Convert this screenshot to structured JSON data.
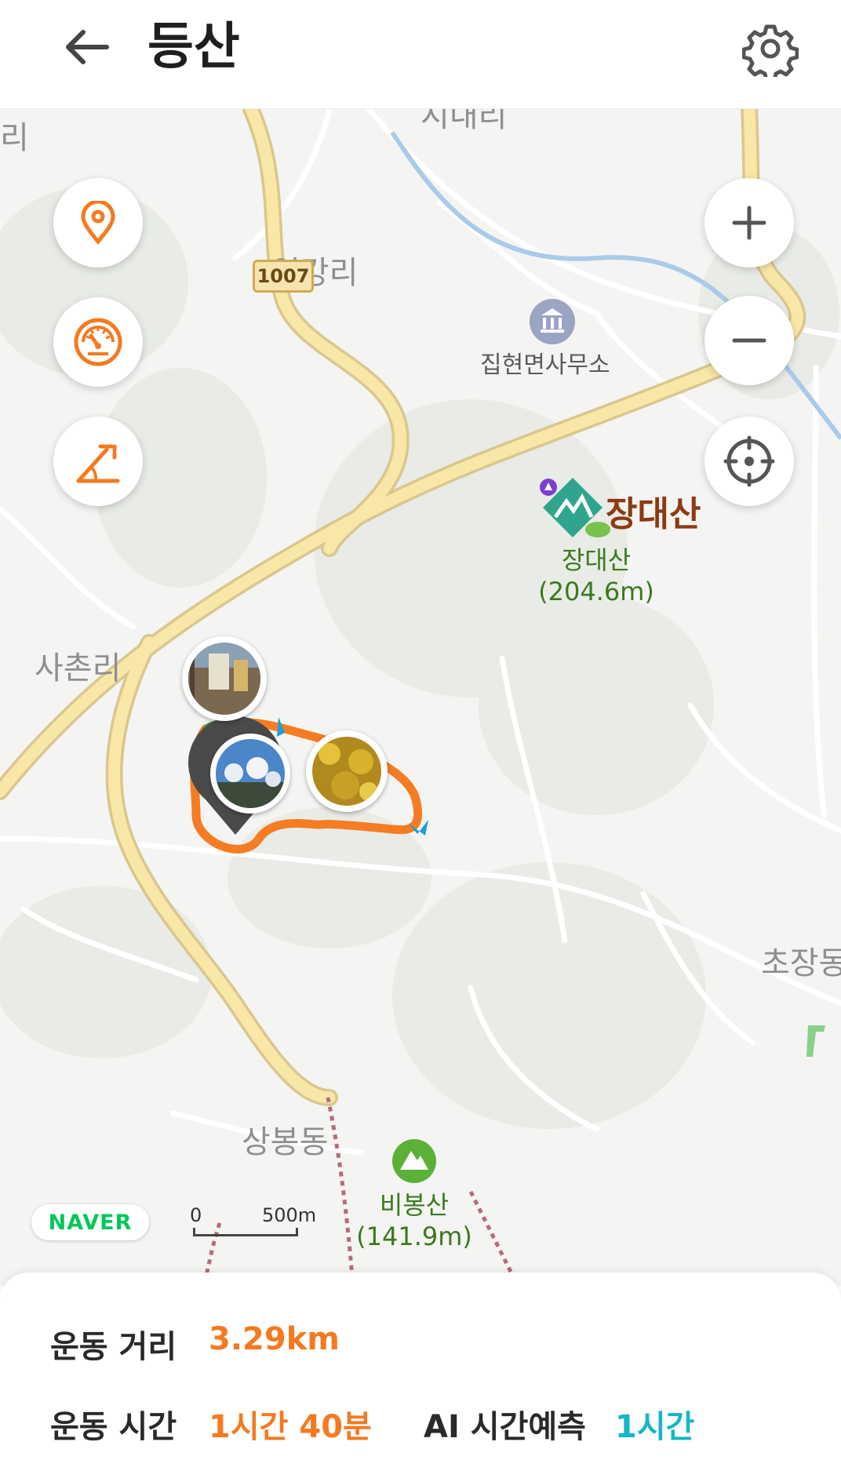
{
  "header": {
    "title": "등산",
    "back_icon": "arrow-left-icon",
    "settings_icon": "gear-icon"
  },
  "map": {
    "place_labels": {
      "top_left_cut": "리",
      "top_center_cut": "시내리",
      "ilgang": "일강리",
      "sachon": "사촌리",
      "sangbong": "상봉동",
      "chojang": "초장동"
    },
    "road_number": "1007",
    "office": "집현면사무소",
    "mountains": [
      {
        "name": "장대산",
        "height": "(204.6m)",
        "banner": "장대산"
      },
      {
        "name": "비봉산",
        "height": "(141.9m)"
      }
    ],
    "zoom_in_icon": "plus-icon",
    "zoom_out_icon": "minus-icon",
    "locate_icon": "crosshair-icon",
    "left_controls": [
      "location-pin-icon",
      "speedometer-icon",
      "slope-angle-icon"
    ],
    "scale": {
      "start": "0",
      "end": "500m"
    },
    "provider": "NAVER"
  },
  "stats": {
    "distance_label": "운동 거리",
    "distance_value": "3.29km",
    "time_label": "운동 시간",
    "time_value": "1시간 40분",
    "ai_label": "AI 시간예측",
    "ai_value": "1시간"
  },
  "colors": {
    "accent_orange": "#f47a20",
    "accent_teal": "#16b6c8",
    "route": "#f57c22",
    "mountain_green": "#3b7a1e"
  }
}
